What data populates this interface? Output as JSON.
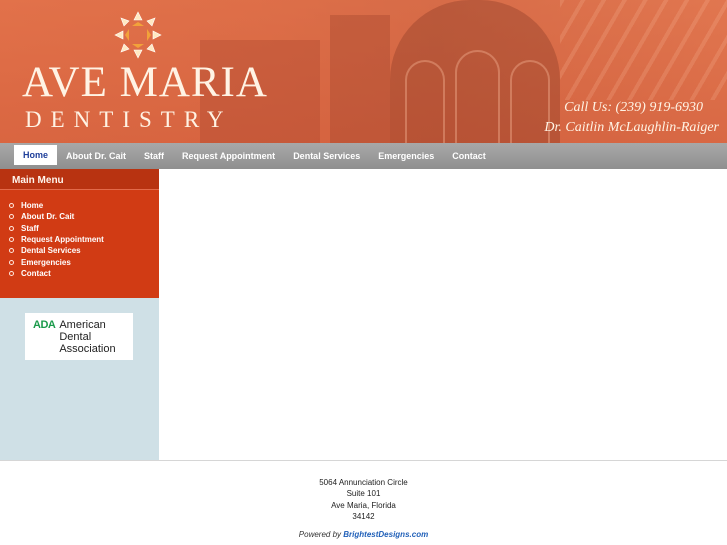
{
  "header": {
    "brand_top": "AVE MARIA",
    "brand_bottom": "DENTISTRY",
    "call_us": "Call Us: (239) 919-6930",
    "doctor": "Dr. Caitlin McLaughlin-Raiger",
    "logo_icon": "star-burst-icon",
    "colors": {
      "header_bg": "#d9704c",
      "brand_text": "#fff3e4"
    }
  },
  "nav": {
    "items": [
      {
        "label": "Home",
        "active": true
      },
      {
        "label": "About Dr. Cait"
      },
      {
        "label": "Staff"
      },
      {
        "label": "Request Appointment"
      },
      {
        "label": "Dental Services"
      },
      {
        "label": "Emergencies"
      },
      {
        "label": "Contact"
      }
    ]
  },
  "sidebar": {
    "menu_title": "Main Menu",
    "items": [
      "Home",
      "About Dr. Cait",
      "Staff",
      "Request Appointment",
      "Dental Services",
      "Emergencies",
      "Contact"
    ],
    "ada": {
      "abbr": "ADA",
      "name_line1": "American",
      "name_line2": "Dental",
      "name_line3": "Association"
    },
    "colors": {
      "menu_bg": "#d13b14",
      "sidebar_bg": "#cfe0e6"
    }
  },
  "footer": {
    "address_line1": "5064 Annunciation Circle",
    "address_line2": "Suite 101",
    "address_line3": "Ave Maria, Florida",
    "address_line4": "34142",
    "powered_prefix": "Powered by",
    "powered_link": "BrightestDesigns.com"
  }
}
